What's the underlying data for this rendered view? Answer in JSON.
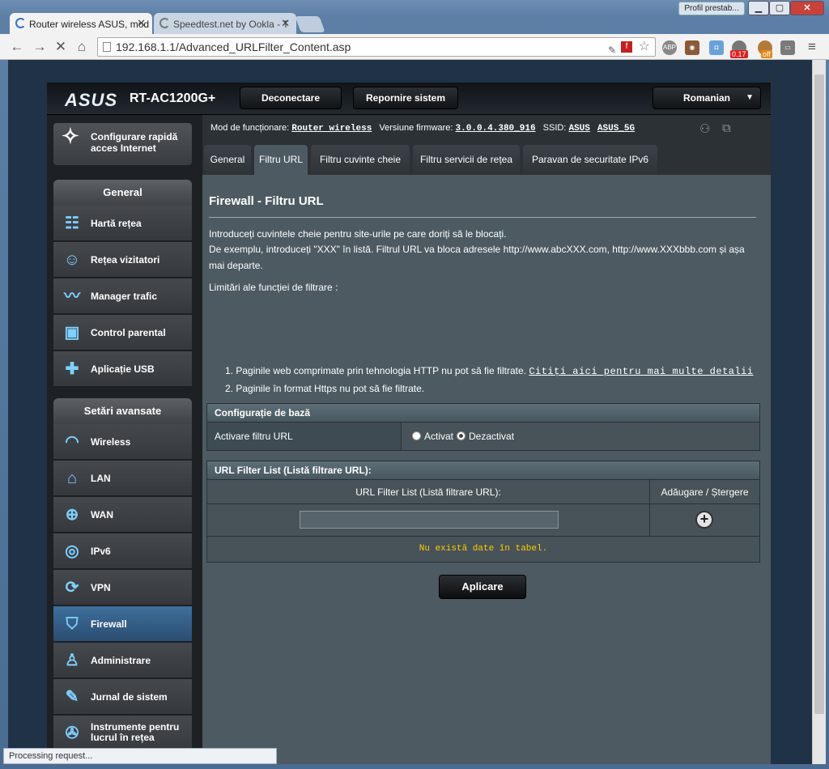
{
  "browser": {
    "tabs": [
      {
        "title": "Router wireless ASUS, mod",
        "close": "✕"
      },
      {
        "title": "Speedtest.net by Ookla - T",
        "close": "✕"
      }
    ],
    "profile_label": "Profil prestab...",
    "url": "192.168.1.1/Advanced_URLFilter_Content.asp",
    "badge_count": "0.17",
    "badge_off": "off",
    "status_text": "Processing request..."
  },
  "router": {
    "logo": "ASUS",
    "model": "RT-AC1200G+",
    "logout_label": "Deconectare",
    "reboot_label": "Repornire sistem",
    "language": "Romanian",
    "info": {
      "mode_label": "Mod de funcționare:",
      "mode_value": "Router wireless",
      "firmware_label": "Versiune firmware:",
      "firmware_value": "3.0.0.4.380_916",
      "ssid_label": "SSID:",
      "ssid_1": "ASUS",
      "ssid_2": "ASUS_5G"
    },
    "sidebar": {
      "quick_setup": "Configurare rapidă acces Internet",
      "general_header": "General",
      "general_items": [
        "Hartă rețea",
        "Rețea vizitatori",
        "Manager trafic",
        "Control parental",
        "Aplicație USB"
      ],
      "advanced_header": "Setări avansate",
      "advanced_items": [
        "Wireless",
        "LAN",
        "WAN",
        "IPv6",
        "VPN",
        "Firewall",
        "Administrare",
        "Jurnal de sistem",
        "Instrumente pentru lucrul în rețea"
      ],
      "active_item": "Firewall"
    },
    "tabs": [
      "General",
      "Filtru URL",
      "Filtru cuvinte cheie",
      "Filtru servicii de rețea",
      "Paravan de securitate IPv6"
    ],
    "active_tab": "Filtru URL",
    "page": {
      "title": "Firewall - Filtru URL",
      "intro_1": "Introduceți cuvintele cheie pentru site-urile pe care doriți să le blocați.",
      "intro_2": "De exemplu, introduceți \"XXX\" în listă. Filtrul URL va bloca adresele http://www.abcXXX.com, http://www.XXXbbb.com și așa mai departe.",
      "limits_title": "Limitări ale funcției de filtrare :",
      "limit_1": "1.  Paginile web comprimate prin tehnologia HTTP nu pot să fie filtrate.",
      "limit_1_link": "Citiți aici pentru mai multe detalii",
      "limit_2": "2.  Paginile în format Https nu pot să fie filtrate.",
      "basic_config_header": "Configurație de bază",
      "enable_label": "Activare filtru URL",
      "radio_on": "Activat",
      "radio_off": "Dezactivat",
      "radio_selected": "Dezactivat",
      "list_header": "URL Filter List (Listă filtrare URL):",
      "col_list": "URL Filter List (Listă filtrare URL):",
      "col_action": "Adăugare / Ștergere",
      "url_input_value": "",
      "add_symbol": "+",
      "no_data": "Nu există date în tabel.",
      "apply_label": "Aplicare"
    }
  },
  "colors": {
    "accent_active": "#3e6f9c",
    "nodata_text": "#ffcc00",
    "icon_blue": "#7fd1ff"
  }
}
